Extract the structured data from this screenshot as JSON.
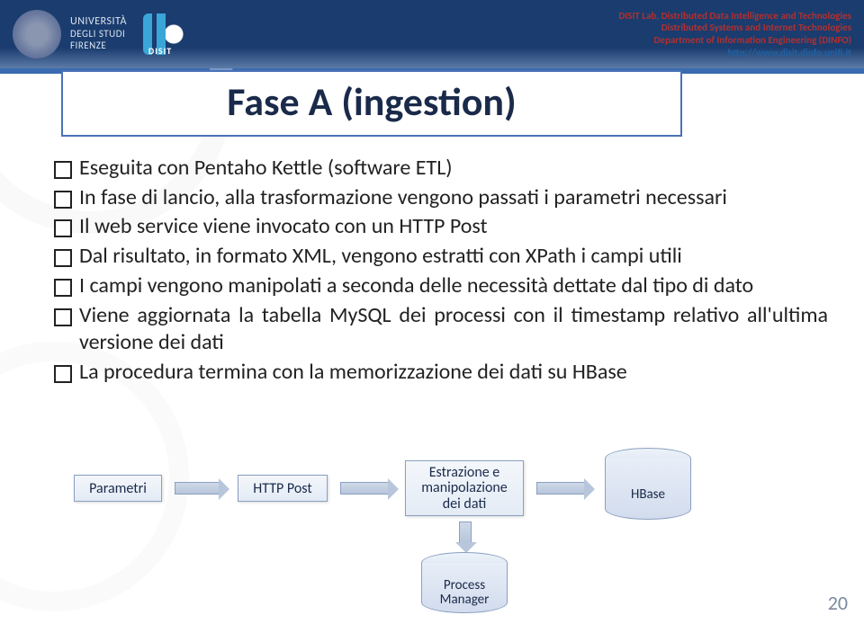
{
  "header": {
    "uni_l1": "UNIVERSITÀ",
    "uni_l2": "DEGLI STUDI",
    "uni_l3": "FIRENZE",
    "r1": "DISIT Lab, Distributed Data Intelligence and Technologies",
    "r2": "Distributed Systems and Internet Technologies",
    "r3": "Department of Information Engineering (DINFO)",
    "r4": "http://www.disit.dinfo.unifi.it"
  },
  "title": "Fase A (ingestion)",
  "bullets": [
    "Eseguita con Pentaho Kettle (software ETL)",
    "In fase di lancio, alla trasformazione vengono passati i parametri necessari",
    "Il web service viene invocato con un HTTP Post",
    "Dal risultato, in formato XML, vengono estratti con XPath i campi utili",
    "I campi vengono manipolati a seconda delle necessità dettate dal tipo di dato",
    "Viene aggiornata la tabella MySQL dei processi con il timestamp relativo all'ultima versione dei dati",
    "La procedura termina con la memorizzazione dei dati su HBase"
  ],
  "diagram": {
    "b1": "Parametri",
    "b2": "HTTP Post",
    "b3_l1": "Estrazione e",
    "b3_l2": "manipolazione",
    "b3_l3": "dei dati",
    "c1": "HBase",
    "c2_l1": "Process",
    "c2_l2": "Manager"
  },
  "page": "20"
}
